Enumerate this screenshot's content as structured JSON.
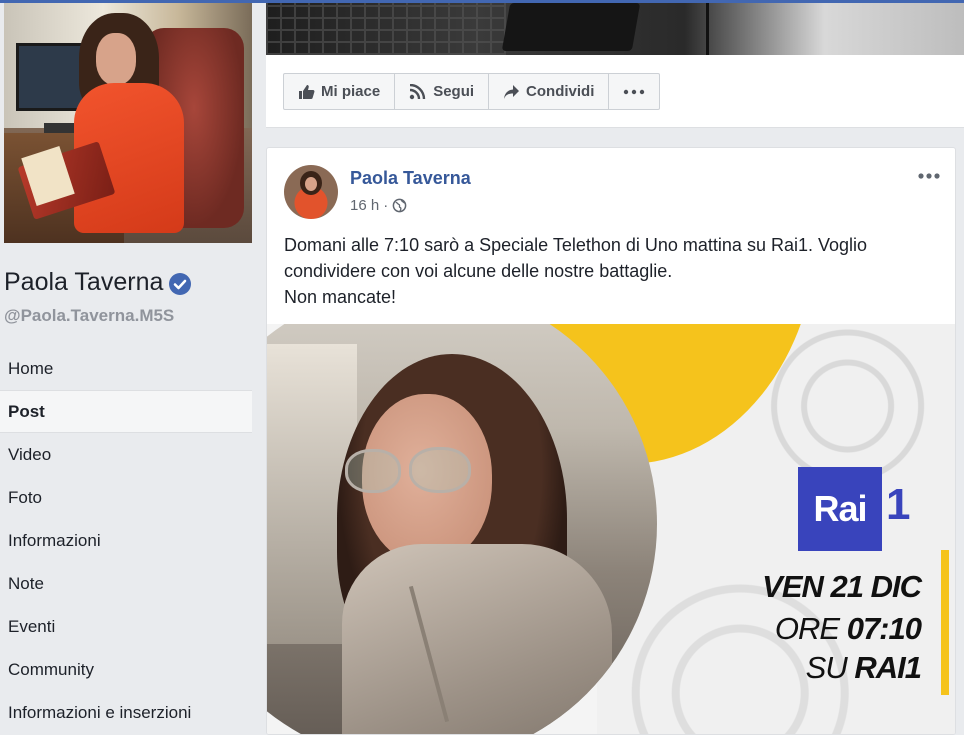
{
  "page": {
    "name": "Paola Taverna",
    "handle": "@Paola.Taverna.M5S"
  },
  "nav": {
    "items": [
      {
        "label": "Home"
      },
      {
        "label": "Post",
        "active": true
      },
      {
        "label": "Video"
      },
      {
        "label": "Foto"
      },
      {
        "label": "Informazioni"
      },
      {
        "label": "Note"
      },
      {
        "label": "Eventi"
      },
      {
        "label": "Community"
      },
      {
        "label": "Informazioni e inserzioni"
      }
    ]
  },
  "actions": {
    "like": "Mi piace",
    "follow": "Segui",
    "share": "Condividi",
    "more_icon": "ellipsis-icon"
  },
  "post": {
    "author": "Paola Taverna",
    "time": "16 h",
    "separator": "·",
    "audience_icon": "globe-icon",
    "text_line1": "Domani alle 7:10 sarò a Speciale Telethon di Uno mattina su Rai1. Voglio condividere con voi alcune delle nostre battaglie.",
    "text_line2": "Non mancate!",
    "image": {
      "logo_text": "Rai",
      "logo_number": "1",
      "line1": "VEN 21 DIC",
      "line2_a": "ORE ",
      "line2_b": "07:10",
      "line3_a": "SU ",
      "line3_b": "RAI1"
    }
  },
  "colors": {
    "accent": "#4267b2",
    "link": "#365899",
    "rai_blue": "#3944bc",
    "yellow": "#f5c31c"
  }
}
